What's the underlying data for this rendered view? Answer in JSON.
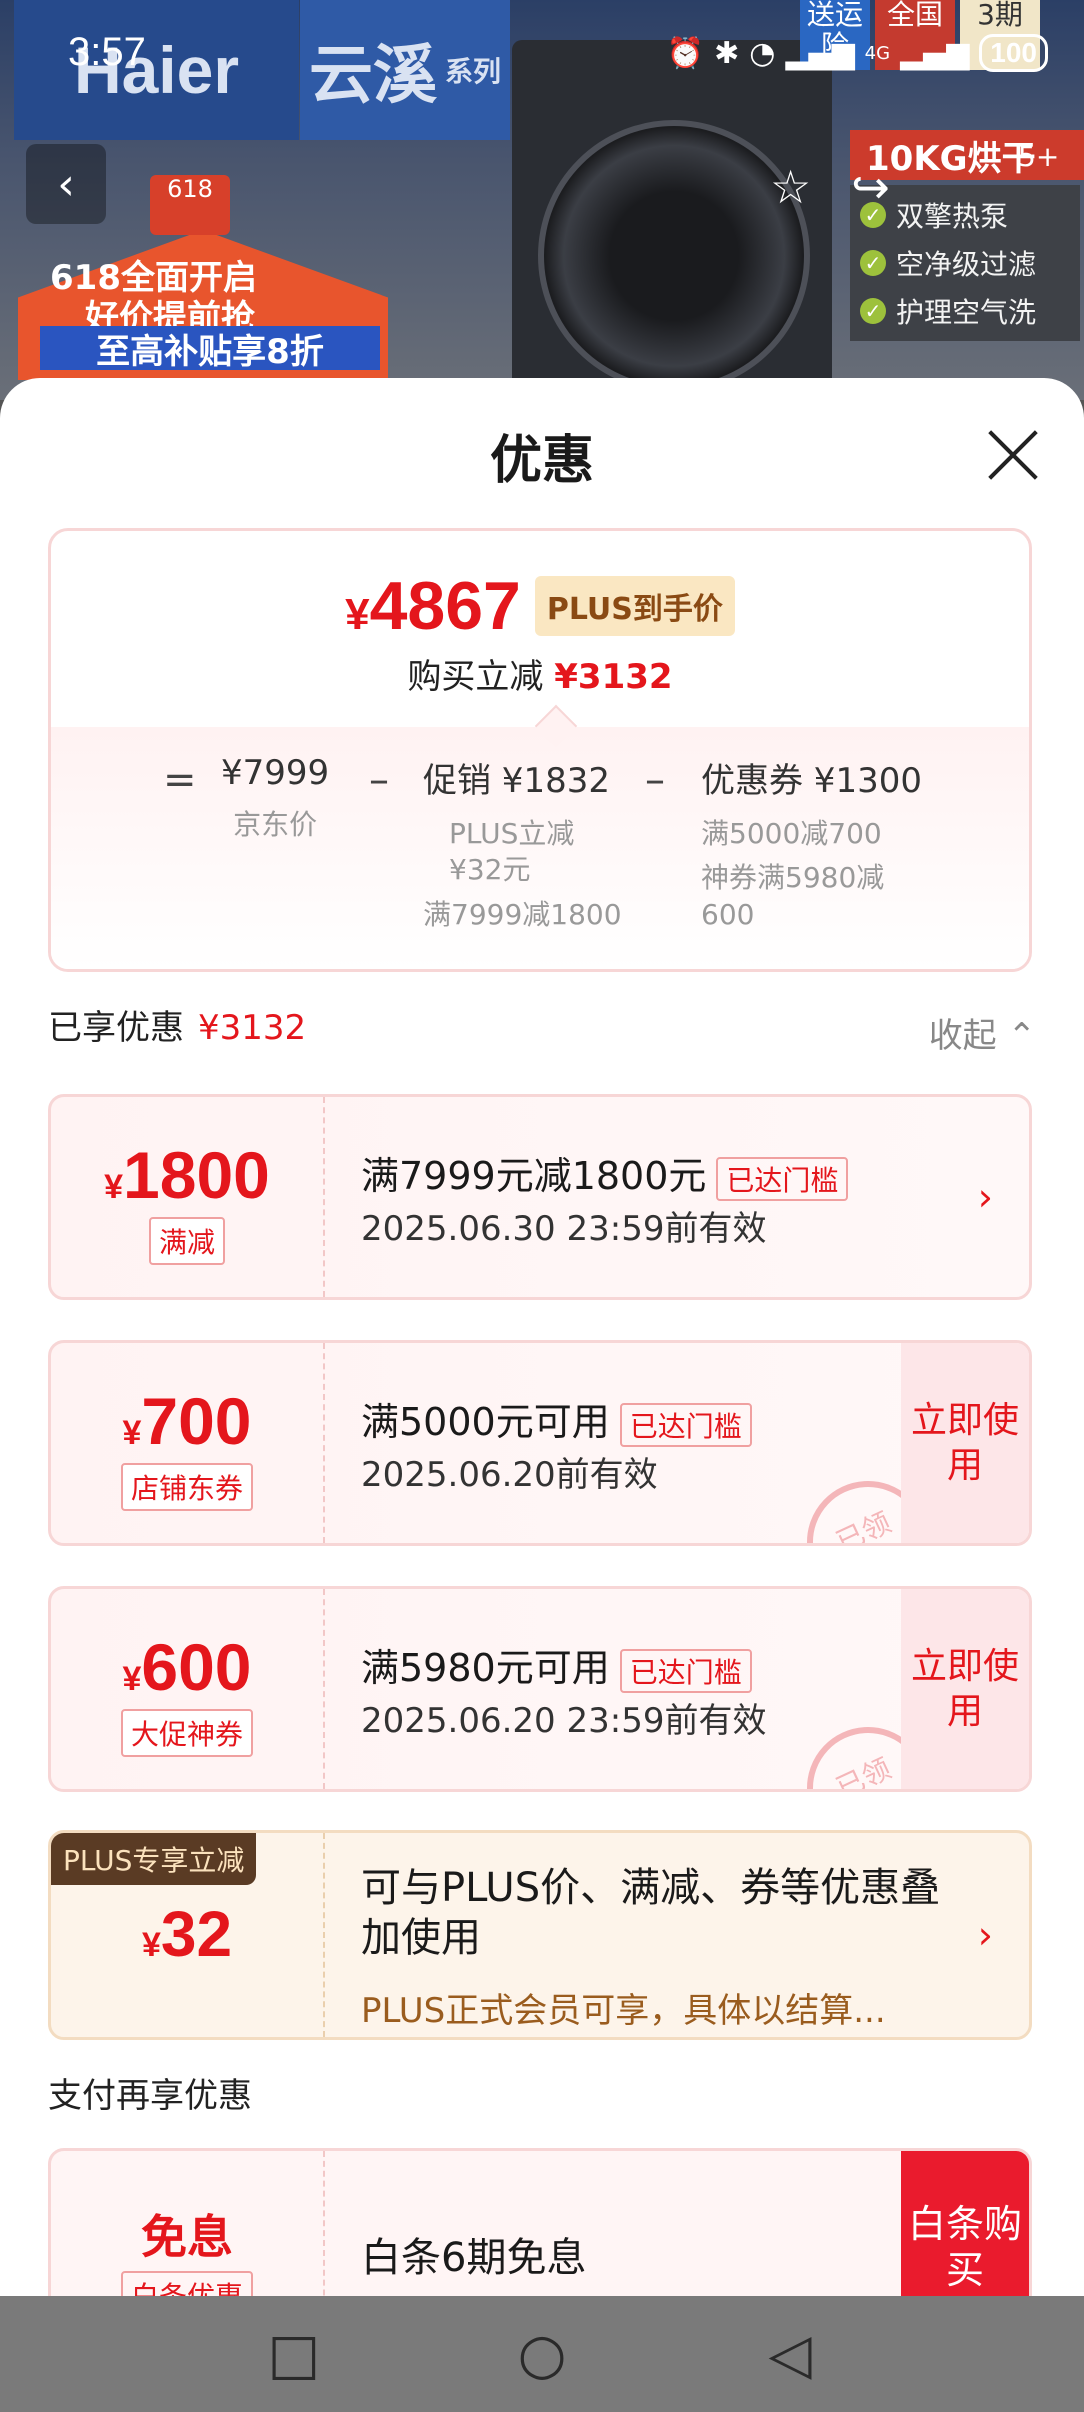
{
  "status_bar": {
    "time": "3:57",
    "battery": "100",
    "network": "4G"
  },
  "background": {
    "brand1": "Haier",
    "brand2": "云溪",
    "brand2_sub": "系列",
    "promo_badge": "618",
    "promo_line1": "618全面开启",
    "promo_line2": "好价提前抢",
    "promo_line3": "至高补贴享8折",
    "right_tag1": "送运 险",
    "right_tag2": "全国",
    "right_tag3": "3期",
    "right_banner": "10KG烘干",
    "image_count": "5+",
    "features": [
      "双擎热泵",
      "空净级过滤",
      "护理空气洗"
    ]
  },
  "sheet": {
    "title": "优惠",
    "summary": {
      "final_price_yen": "¥",
      "final_price": "4867",
      "plus_badge": "PLUS到手价",
      "reduce_label": "购买立减",
      "reduce_value": "¥3132",
      "eq": "=",
      "minus": "–",
      "jd_price": "¥7999",
      "jd_label": "京东价",
      "promo_label": "促销 ¥1832",
      "promo_sub1": "PLUS立减",
      "promo_sub2": "¥32元",
      "promo_sub3": "满7999减1800",
      "coupon_label": "优惠券 ¥1300",
      "coupon_sub1": "满5000减700",
      "coupon_sub2": "神券满5980减",
      "coupon_sub3": "600"
    },
    "enjoyed": {
      "label": "已享优惠",
      "value": "¥3132",
      "collapse": "收起"
    },
    "coupons": [
      {
        "yen": "¥",
        "amount": "1800",
        "tag": "满减",
        "main": "满7999元减1800元",
        "badge": "已达门槛",
        "date": "2025.06.30 23:59前有效"
      },
      {
        "yen": "¥",
        "amount": "700",
        "tag": "店铺东券",
        "main": "满5000元可用",
        "badge": "已达门槛",
        "date": "2025.06.20前有效",
        "action": "立即使用",
        "stamp": "已领"
      },
      {
        "yen": "¥",
        "amount": "600",
        "tag": "大促神券",
        "main": "满5980元可用",
        "badge": "已达门槛",
        "date": "2025.06.20 23:59前有效",
        "action": "立即使用",
        "stamp": "已领"
      }
    ],
    "plus": {
      "ribbon": "PLUS专享立减",
      "yen": "¥",
      "amount": "32",
      "main": "可与PLUS价、满减、券等优惠叠加使用",
      "sub": "PLUS正式会员可享，具体以结算..."
    },
    "pay_section_title": "支付再享优惠",
    "pay": {
      "big": "免息",
      "tag": "白条优惠",
      "main": "白条6期免息",
      "buy": "白条购买"
    }
  },
  "colors": {
    "accent_red": "#e4161c",
    "plus_gold": "#fae7c2"
  }
}
